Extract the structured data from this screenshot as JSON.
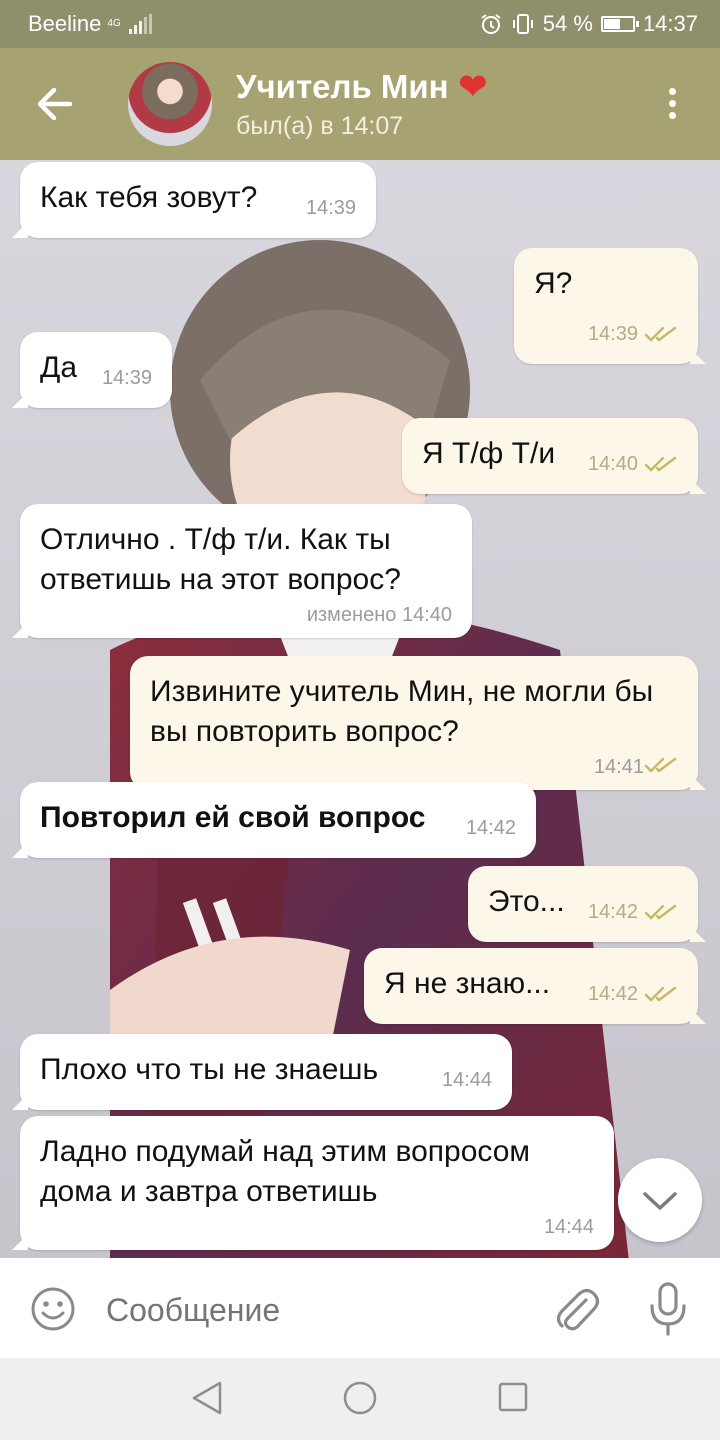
{
  "status_bar": {
    "carrier": "Beeline",
    "network": "4G",
    "battery_percent": "54 %",
    "time": "14:37"
  },
  "header": {
    "title": "Учитель Мин",
    "title_emoji": "❤",
    "subtitle": "был(а) в 14:07"
  },
  "messages": [
    {
      "dir": "in",
      "text": "Как тебя зовут?",
      "time": "14:39"
    },
    {
      "dir": "out",
      "text": "Я?",
      "time": "14:39"
    },
    {
      "dir": "in",
      "text": "Да",
      "time": "14:39"
    },
    {
      "dir": "out",
      "text": "Я Т/ф Т/и",
      "time": "14:40"
    },
    {
      "dir": "in",
      "text": "Отлично . Т/ф т/и. Как ты ответишь на этот вопрос?",
      "time": "изменено 14:40"
    },
    {
      "dir": "out",
      "text": "Извините учитель Мин, не могли бы вы повторить вопрос?",
      "time": "14:41"
    },
    {
      "dir": "in",
      "text": "Повторил ей свой вопрос",
      "time": "14:42",
      "bold": true
    },
    {
      "dir": "out",
      "text": "Это...",
      "time": "14:42"
    },
    {
      "dir": "out",
      "text": "Я не знаю...",
      "time": "14:42"
    },
    {
      "dir": "in",
      "text": "Плохо что ты не знаешь",
      "time": "14:44"
    },
    {
      "dir": "in",
      "text": "Ладно подумай над этим вопросом дома и завтра ответишь",
      "time": "14:44"
    }
  ],
  "input": {
    "placeholder": "Сообщение"
  },
  "icons": {
    "back": "arrow-left-icon",
    "menu": "more-vertical-icon",
    "emoji": "smiley-icon",
    "attach": "paperclip-icon",
    "mic": "microphone-icon",
    "scroll_down": "chevron-down-icon",
    "read": "double-check-icon"
  },
  "colors": {
    "header": "#a6a271",
    "status_bar": "#8f8f6b",
    "outgoing_bubble": "#fcf7e8",
    "incoming_bubble": "#ffffff"
  }
}
